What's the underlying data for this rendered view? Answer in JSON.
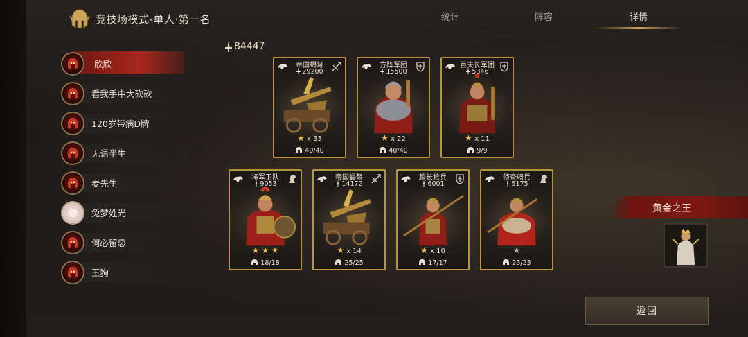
{
  "header": {
    "title": "竞技场模式-单人·第一名",
    "tabs": [
      {
        "label": "统计"
      },
      {
        "label": "阵容"
      },
      {
        "label": "详情",
        "active": true
      }
    ]
  },
  "players": [
    {
      "name": "欣欣",
      "active": true,
      "avatar": "red-helmet"
    },
    {
      "name": "看我手中大砍砍",
      "avatar": "red-helmet"
    },
    {
      "name": "120岁带病D牌",
      "avatar": "red-helmet"
    },
    {
      "name": "无语半生",
      "avatar": "red-helmet"
    },
    {
      "name": "麦先生",
      "avatar": "red-helmet"
    },
    {
      "name": "兔梦姓光",
      "avatar": "pale-circle"
    },
    {
      "name": "何必留恋",
      "avatar": "red-helmet"
    },
    {
      "name": "王狗",
      "avatar": "red-helmet"
    }
  ],
  "total_power": "84447",
  "units": [
    {
      "name": "帝国蝎弩",
      "power": "29200",
      "stars": "x 33",
      "troops": "40/40",
      "type_icon": "bow-icon",
      "art": "ballista"
    },
    {
      "name": "方阵军团",
      "power": "15500",
      "stars": "x 22",
      "troops": "40/40",
      "type_icon": "shield-icon",
      "art": "legionary"
    },
    {
      "name": "百夫长军团",
      "power": "5346",
      "stars": "x 11",
      "troops": "9/9",
      "type_icon": "shield-icon",
      "art": "centurion"
    },
    {
      "name": "将军卫队",
      "power": "9053",
      "stars": "",
      "star_count": 3,
      "troops": "18/18",
      "type_icon": "horse-icon",
      "art": "general"
    },
    {
      "name": "帝国蝎弩",
      "power": "14172",
      "stars": "x 14",
      "troops": "25/25",
      "type_icon": "bow-icon",
      "art": "ballista"
    },
    {
      "name": "超长枪兵",
      "power": "6001",
      "stars": "x 10",
      "troops": "17/17",
      "type_icon": "shield-icon",
      "art": "spearman"
    },
    {
      "name": "侦查骑兵",
      "power": "5175",
      "stars": "",
      "star_count": 1,
      "star_grey": true,
      "troops": "23/23",
      "type_icon": "horse-icon",
      "art": "scout"
    }
  ],
  "hero": {
    "title": "黄金之王"
  },
  "buttons": {
    "back": "返回"
  },
  "colors": {
    "accent_gold": "#b8943c",
    "banner_red": "#7e1912",
    "star": "#f1c14a"
  }
}
